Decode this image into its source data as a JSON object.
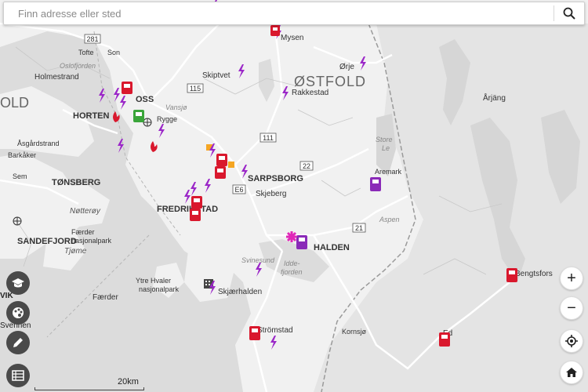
{
  "search": {
    "placeholder": "Finn adresse eller sted"
  },
  "places": {
    "ostfold": "ØSTFOLD",
    "fold": "OLD",
    "mysen": "Mysen",
    "orje": "Ørje",
    "skiptvet": "Skiptvet",
    "rakkestad": "Rakkestad",
    "arjang": "Årjäng",
    "tofte": "Tofte",
    "son": "Son",
    "oslofjorden": "Oslofjorden",
    "holmestrand": "Holmestrand",
    "moss": "OSS",
    "vansjo": "Vansjø",
    "rygge": "Rygge",
    "horten": "HORTEN",
    "asgardstrand": "Åsgårdstrand",
    "barkaker": "Barkåker",
    "sem": "Sem",
    "tonsberg": "TØNSBERG",
    "store_le": "Store\nLe",
    "aremark": "Aremark",
    "sarpsborg": "SARPSBORG",
    "skjeberg": "Skjeberg",
    "notteroy": "Nøtterøy",
    "fredrikstad": "FREDRIKSTAD",
    "aspen": "Aspen",
    "sandefjord": "SANDEFJORD",
    "faerder_np1": "Færder",
    "faerder_np2": "nasjonalpark",
    "tjome": "Tjøme",
    "halden": "HALDEN",
    "iddefjorden": "Idde-\nfjorden",
    "svinesund": "Svinesund",
    "hvaler1": "Ytre Hvaler",
    "hvaler2": "nasjonalpark",
    "skjaerhalden": "Skjærhalden",
    "faerder": "Færder",
    "bengtsfors": "Bengtsfors",
    "stromstad": "Strömstad",
    "ed": "Ed",
    "kornsjo": "Kornsjø",
    "vik": "VIK",
    "svennen": "Svennen"
  },
  "roads": [
    "281",
    "115",
    "111",
    "22",
    "21",
    "E6"
  ],
  "scale_label": "20km",
  "zoom": {
    "in": "+",
    "out": "−"
  },
  "colors": {
    "land": "#f2f2f2",
    "water": "#d9d9d9",
    "road": "#ffffff",
    "border": "#9a9a9a",
    "charging": "#9b27c8",
    "fuel_red": "#d9182d",
    "fuel_purple": "#8a2ab8",
    "fuel_green": "#3aa53a",
    "orange": "#f5a623",
    "pink": "#e028b8"
  }
}
